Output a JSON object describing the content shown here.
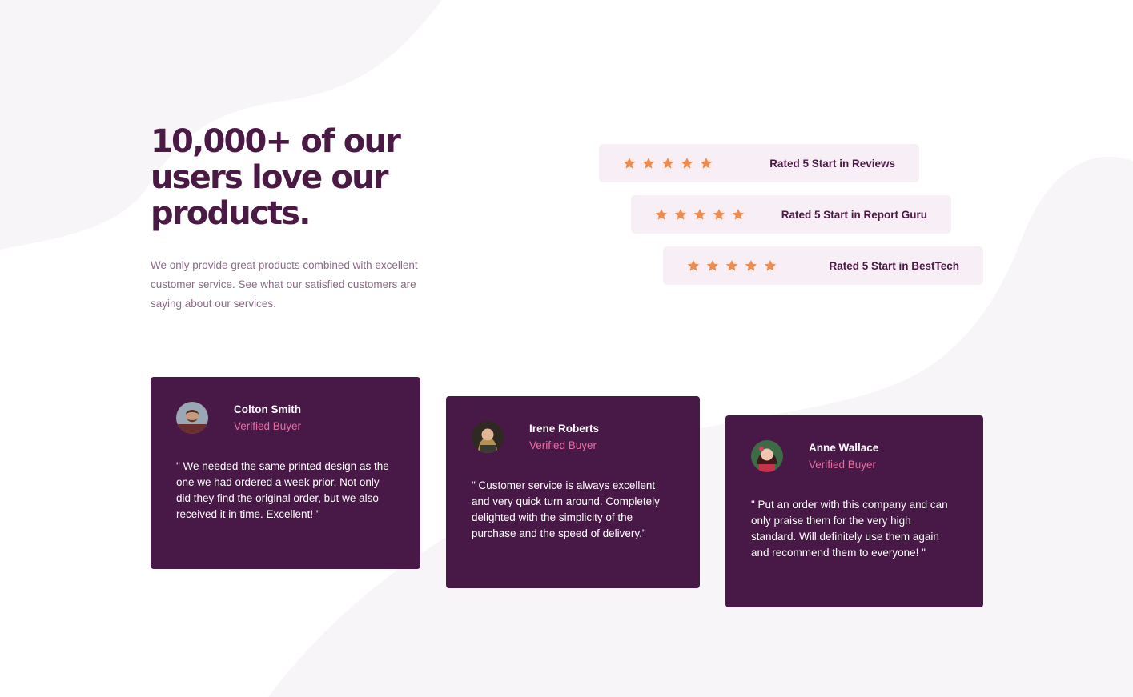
{
  "intro": {
    "headline": "10,000+ of our users love our products.",
    "text": "We only provide great products combined with excellent customer service. See what our satisfied customers are saying about our services."
  },
  "colors": {
    "dark_purple": "#4a1a45",
    "card_bg": "#481846",
    "rating_bg": "#f7eff5",
    "star": "#ee8b4e",
    "accent_pink": "#e86ea4",
    "muted_text": "#8a6a86"
  },
  "ratings": [
    {
      "stars": 5,
      "label": "Rated 5 Start in Reviews"
    },
    {
      "stars": 5,
      "label": "Rated 5 Start in Report Guru"
    },
    {
      "stars": 5,
      "label": "Rated 5 Start in BestTech"
    }
  ],
  "testimonials": [
    {
      "name": "Colton Smith",
      "role": "Verified Buyer",
      "avatar_icon": "avatar-colton",
      "quote": "\" We needed the same printed design as the one we had ordered a week prior. Not only did they find the original order, but we also received it in time. Excellent! \""
    },
    {
      "name": "Irene Roberts",
      "role": "Verified Buyer",
      "avatar_icon": "avatar-irene",
      "quote": "\" Customer service is always excellent and very quick turn around. Completely delighted with the simplicity of the purchase and the speed of delivery.\""
    },
    {
      "name": "Anne Wallace",
      "role": "Verified Buyer",
      "avatar_icon": "avatar-anne",
      "quote": "\" Put an order with this company and can only praise them for the very high standard. Will definitely use them again and recommend them to everyone! \""
    }
  ]
}
